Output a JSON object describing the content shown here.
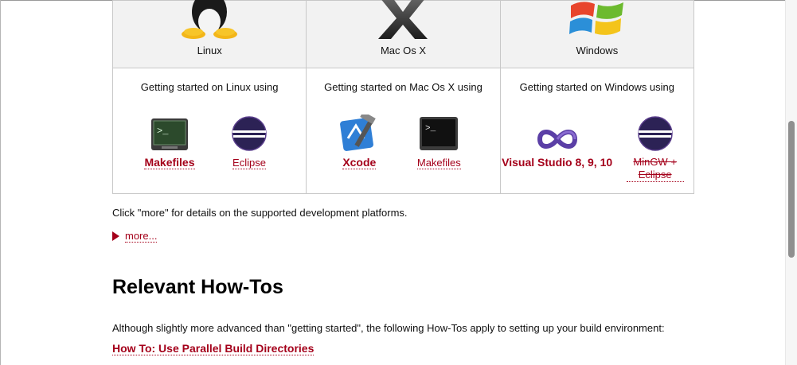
{
  "platforms": [
    {
      "name": "Linux",
      "started_text": "Getting started on Linux using",
      "tools": [
        {
          "label": "Makefiles",
          "bold": true,
          "icon": "terminal-green-icon"
        },
        {
          "label": "Eclipse",
          "bold": false,
          "icon": "eclipse-icon"
        }
      ]
    },
    {
      "name": "Mac Os X",
      "started_text": "Getting started on Mac Os X using",
      "tools": [
        {
          "label": "Xcode",
          "bold": true,
          "icon": "xcode-icon"
        },
        {
          "label": "Makefiles",
          "bold": false,
          "icon": "terminal-icon"
        }
      ]
    },
    {
      "name": "Windows",
      "started_text": "Getting started on Windows using",
      "tools": [
        {
          "label": "Visual Studio 8, 9, 10",
          "bold": true,
          "icon": "visual-studio-icon"
        },
        {
          "label": "MinGW + Eclipse",
          "bold": false,
          "strike": true,
          "icon": "eclipse-icon"
        }
      ]
    }
  ],
  "note": "Click \"more\" for details on the supported development platforms.",
  "more_label": "more...",
  "section_title": "Relevant How-Tos",
  "paragraph": "Although slightly more advanced than \"getting started\", the following How-Tos apply to setting up your build environment:",
  "howto_link": "How To: Use Parallel Build Directories",
  "colors": {
    "link": "#a4001a",
    "os_cell_bg": "#f2f2f2",
    "border": "#c8c8c8"
  }
}
